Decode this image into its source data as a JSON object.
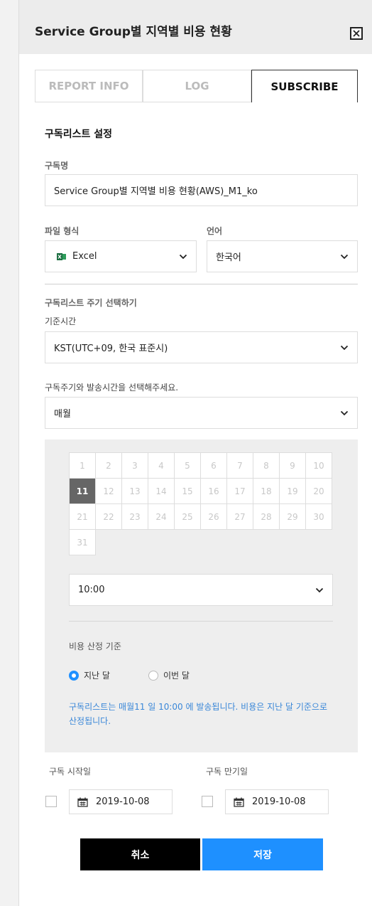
{
  "panel": {
    "title": "Service Group별 지역별 비용 현황"
  },
  "tabs": [
    {
      "label": "REPORT INFO",
      "active": false
    },
    {
      "label": "LOG",
      "active": false
    },
    {
      "label": "SUBSCRIBE",
      "active": true
    }
  ],
  "form": {
    "section_title": "구독리스트 설정",
    "name_label": "구독명",
    "name_value": "Service Group별 지역별 비용 현황(AWS)_M1_ko",
    "file_format_label": "파일 형식",
    "file_format_value": "Excel",
    "file_format_icon": "excel-icon",
    "language_label": "언어",
    "language_value": "한국어",
    "cycle_title": "구독리스트 주기 선택하기",
    "timezone_label": "기준시간",
    "timezone_value": "KST(UTC+09, 한국 표준시)",
    "cycle_prompt": "구독주기와 발송시간을 선택해주세요.",
    "cycle_value": "매월"
  },
  "schedule": {
    "days": [
      "1",
      "2",
      "3",
      "4",
      "5",
      "6",
      "7",
      "8",
      "9",
      "10",
      "11",
      "12",
      "13",
      "14",
      "15",
      "16",
      "17",
      "18",
      "19",
      "20",
      "21",
      "22",
      "23",
      "24",
      "25",
      "26",
      "27",
      "28",
      "29",
      "30",
      "31"
    ],
    "selected_day": "11",
    "time_value": "10:00",
    "cost_basis_label": "비용 산정 기준",
    "options": [
      {
        "label": "지난 달",
        "checked": true
      },
      {
        "label": "이번 달",
        "checked": false
      }
    ],
    "notice": "구독리스트는 매월11 일 10:00 에 발송됩니다. 비용은 지난 달 기준으로 산정됩니다."
  },
  "dates": {
    "start_label": "구독 시작일",
    "start_value": "2019-10-08",
    "start_checked": false,
    "end_label": "구독 만기일",
    "end_value": "2019-10-08",
    "end_checked": false
  },
  "actions": {
    "cancel_label": "취소",
    "save_label": "저장"
  },
  "colors": {
    "accent": "#1e90ff",
    "save_button": "#1e90ff",
    "cancel_button": "#000000",
    "notice_text": "#3a87d8",
    "selected_day_bg": "#666666"
  }
}
